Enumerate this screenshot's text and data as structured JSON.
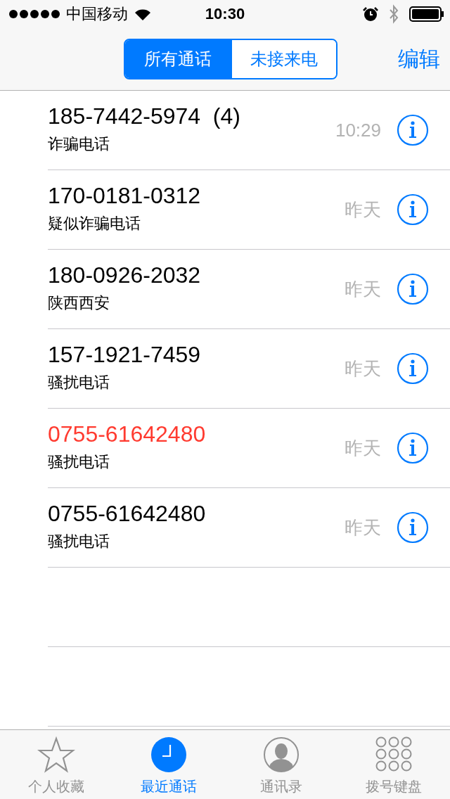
{
  "status_bar": {
    "carrier": "中国移动",
    "time": "10:30"
  },
  "nav": {
    "segments": [
      {
        "label": "所有通话",
        "selected": true
      },
      {
        "label": "未接来电",
        "selected": false
      }
    ],
    "edit": "编辑"
  },
  "calls": [
    {
      "number": "185-7442-5974  (4)",
      "label": "诈骗电话",
      "time": "10:29",
      "missed": false
    },
    {
      "number": "170-0181-0312",
      "label": "疑似诈骗电话",
      "time": "昨天",
      "missed": false
    },
    {
      "number": "180-0926-2032",
      "label": "陕西西安",
      "time": "昨天",
      "missed": false
    },
    {
      "number": "157-1921-7459",
      "label": "骚扰电话",
      "time": "昨天",
      "missed": false
    },
    {
      "number": "0755-61642480",
      "label": "骚扰电话",
      "time": "昨天",
      "missed": true
    },
    {
      "number": "0755-61642480",
      "label": "骚扰电话",
      "time": "昨天",
      "missed": false
    }
  ],
  "tab_bar": [
    {
      "kind": "star",
      "label": "个人收藏",
      "selected": false
    },
    {
      "kind": "clock",
      "label": "最近通话",
      "selected": true
    },
    {
      "kind": "person",
      "label": "通讯录",
      "selected": false
    },
    {
      "kind": "keypad",
      "label": "拨号键盘",
      "selected": false
    }
  ]
}
